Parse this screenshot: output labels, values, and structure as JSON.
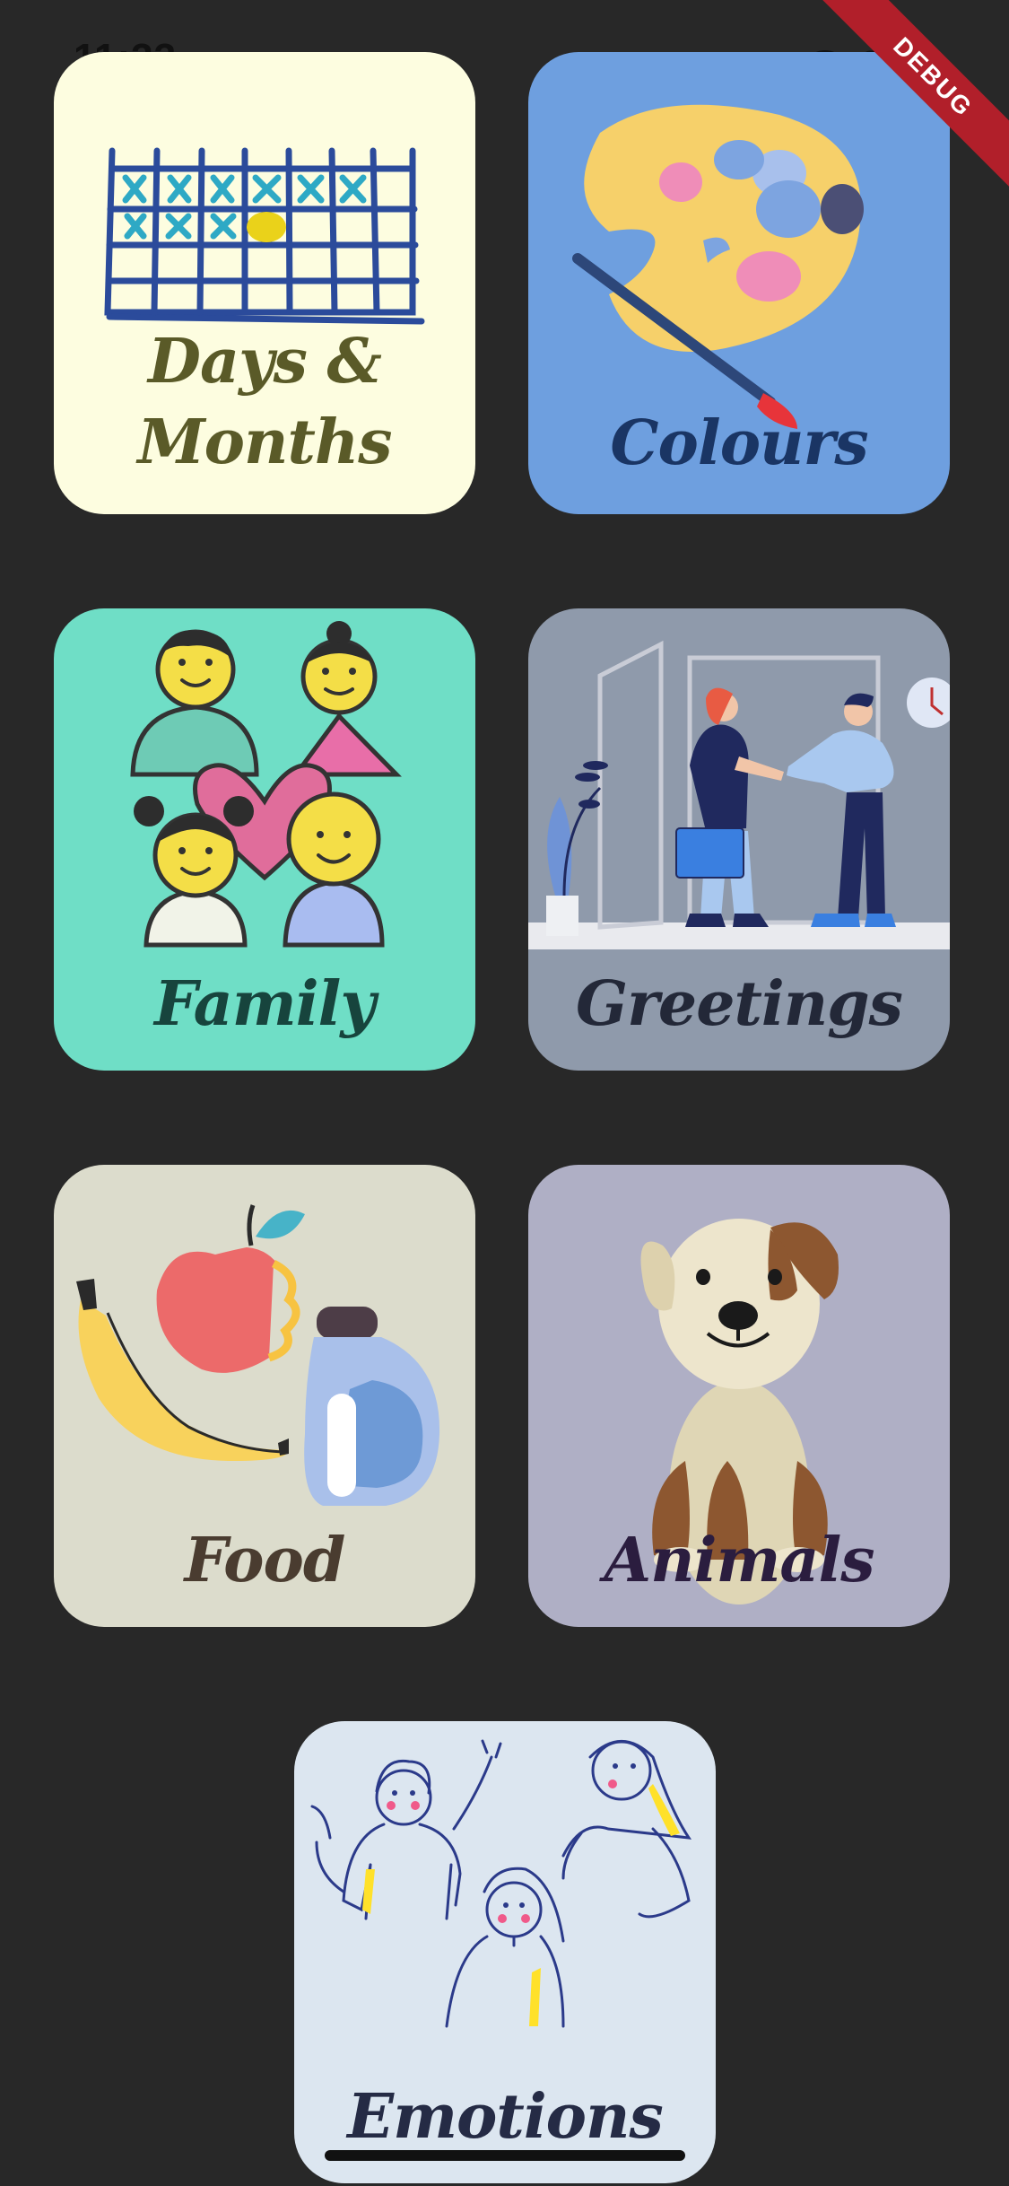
{
  "status_bar": {
    "time": "11:33"
  },
  "debug_banner": "DEBUG",
  "cards": [
    {
      "title_line1": "Days &",
      "title_line2": "Months",
      "background": "#fdfde0",
      "text_color": "#5a5a28",
      "illustration": "calendar"
    },
    {
      "title": "Colours",
      "background": "#6e9fdf",
      "text_color": "#1a3564",
      "illustration": "paint-palette"
    },
    {
      "title": "Family",
      "background": "#6fdec6",
      "text_color": "#17443d",
      "illustration": "family-faces"
    },
    {
      "title": "Greetings",
      "background": "#8f9aab",
      "text_color": "#232838",
      "illustration": "handshake"
    },
    {
      "title": "Food",
      "background": "#dcdccc",
      "text_color": "#4a3c30",
      "illustration": "fruit-and-jar"
    },
    {
      "title": "Animals",
      "background": "#afafc5",
      "text_color": "#2b1d3f",
      "illustration": "puppy"
    },
    {
      "title": "Emotions",
      "background": "#dce6f0",
      "text_color": "#252b45",
      "illustration": "people-emotions"
    }
  ]
}
